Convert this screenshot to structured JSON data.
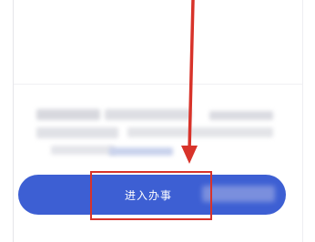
{
  "main": {
    "enter_button_label": "进入办事"
  },
  "annotation": {
    "color": "#d8332a"
  },
  "colors": {
    "button_bg": "#3d5fd3",
    "button_text": "#ffffff",
    "background": "#ffffff"
  }
}
